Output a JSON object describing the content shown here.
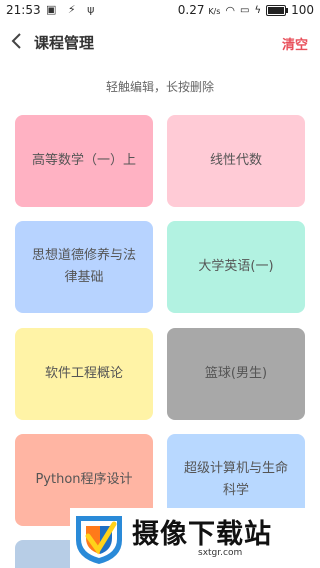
{
  "status": {
    "time": "21:53",
    "speed": "0.27",
    "speed_unit": "K/s",
    "battery": "100",
    "battery_level": 1.0
  },
  "header": {
    "title": "课程管理",
    "clear_label": "清空"
  },
  "hint": "轻触编辑，长按删除",
  "courses": [
    {
      "name": "高等数学（一）上",
      "color": "#ffb2c3"
    },
    {
      "name": "线性代数",
      "color": "#ffcbd6"
    },
    {
      "name": "思想道德修养与法律基础",
      "color": "#b7d3ff"
    },
    {
      "name": "大学英语(一)",
      "color": "#b2f2e1"
    },
    {
      "name": "软件工程概论",
      "color": "#fff3a6"
    },
    {
      "name": "篮球(男生)",
      "color": "#a8a8a8"
    },
    {
      "name": "Python程序设计",
      "color": "#ffb5a3"
    },
    {
      "name": "超级计算机与生命科学",
      "color": "#b8d8ff"
    }
  ],
  "watermark": {
    "text": "摄像下载站",
    "url": "sxtgr.com"
  }
}
